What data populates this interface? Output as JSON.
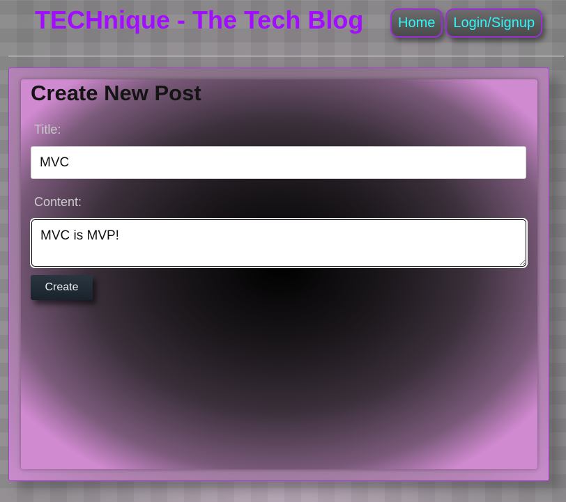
{
  "header": {
    "title": "TECHnique - The Tech Blog",
    "nav": {
      "home_label": "Home",
      "login_label": "Login/Signup"
    }
  },
  "form": {
    "heading": "Create New Post",
    "title_label": "Title:",
    "title_value": "MVC",
    "content_label": "Content:",
    "content_value": "MVC is MVP!",
    "submit_label": "Create"
  },
  "colors": {
    "brand_title": "#a20cff",
    "nav_text": "#2ef6f9",
    "nav_border": "#9b2fd6",
    "button_bg": "#1f2a34"
  }
}
